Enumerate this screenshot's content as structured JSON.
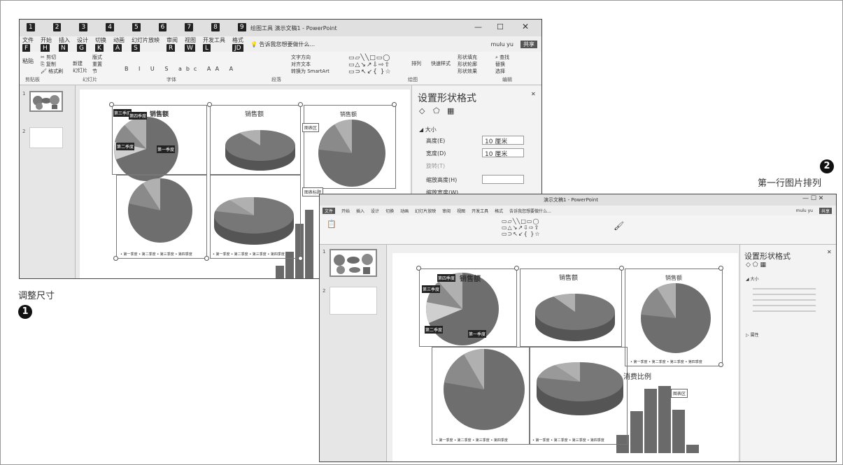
{
  "captions": {
    "step1_label": "调整尺寸",
    "step1_number": "1",
    "step2_label": "第一行图片排列",
    "step2_number": "2"
  },
  "window1": {
    "title": "绘图工具  演示文稿1 - PowerPoint",
    "tabs": [
      "文件",
      "开始",
      "插入",
      "设计",
      "切换",
      "动画",
      "幻灯片放映",
      "审阅",
      "视图",
      "开发工具",
      "格式"
    ],
    "keytips": [
      "F",
      "H",
      "N",
      "G",
      "K",
      "A",
      "S",
      "R",
      "W",
      "L",
      "JD"
    ],
    "top_keytips": [
      "1",
      "2",
      "3",
      "4",
      "5",
      "6",
      "7",
      "8",
      "9"
    ],
    "tell_me": "告诉我您想要做什么...",
    "user": "mulu yu",
    "share": "共享",
    "ribbon": {
      "paste": "粘贴",
      "cut": "剪切",
      "copy": "复制",
      "format_painter": "格式刷",
      "new_slide": "新建\n幻灯片",
      "layout": "版式",
      "reset": "重置",
      "section": "节",
      "text_direction": "文字方向",
      "align_text": "对齐文本",
      "smartart": "转换为 SmartArt",
      "arrange": "排列",
      "quick_styles": "快速样式",
      "shape_fill": "形状填充",
      "shape_outline": "形状轮廓",
      "shape_effects": "形状效果",
      "find": "查找",
      "replace": "替换",
      "select": "选择",
      "groups": [
        "剪贴板",
        "幻灯片",
        "字体",
        "段落",
        "绘图",
        "编辑"
      ]
    },
    "chart_titles": [
      "销售额",
      "销售额",
      "销售额"
    ],
    "tooltips": [
      "图表区",
      "图表标题"
    ],
    "data_labels": [
      "第三季度",
      "第四季度",
      "第二季度",
      "第一季度"
    ],
    "legend": "• 第一季度  • 第二季度  • 第三季度  • 第四季度",
    "pane": {
      "title": "设置形状格式",
      "section": "大小",
      "height_label": "高度(E)",
      "height_value": "10 厘米",
      "width_label": "宽度(D)",
      "width_value": "10 厘米",
      "rotation_label": "旋转(T)",
      "scale_h_label": "缩放高度(H)",
      "scale_w_label": "缩放宽度(W)"
    },
    "slide_numbers": [
      "1",
      "2"
    ]
  },
  "window2": {
    "title": "演示文稿1 - PowerPoint",
    "tabs": [
      "文件",
      "开始",
      "插入",
      "设计",
      "切换",
      "动画",
      "幻灯片放映",
      "审阅",
      "视图",
      "开发工具",
      "格式"
    ],
    "tell_me": "告诉我您想要做什么...",
    "user": "mulu yu",
    "share": "共享",
    "chart_titles": [
      "销售额",
      "销售额",
      "销售额"
    ],
    "tooltips": [
      "图表区"
    ],
    "hist_title": "消费比例",
    "data_labels": [
      "第四季度",
      "第三季度",
      "第二季度",
      "第一季度"
    ],
    "legend": "• 第一季度  • 第二季度  • 第三季度  • 第四季度",
    "pane": {
      "title": "设置形状格式",
      "section1": "大小",
      "section2": "属性"
    },
    "slide_numbers": [
      "1",
      "2"
    ]
  },
  "colors": {
    "pie_dark": "#6e6e6e",
    "pie_mid": "#8a8a8a",
    "pie_light": "#b0b0b0",
    "pie_lighter": "#cfcfcf",
    "bar": "#6a6a6a",
    "keytip_bg": "#222222"
  }
}
